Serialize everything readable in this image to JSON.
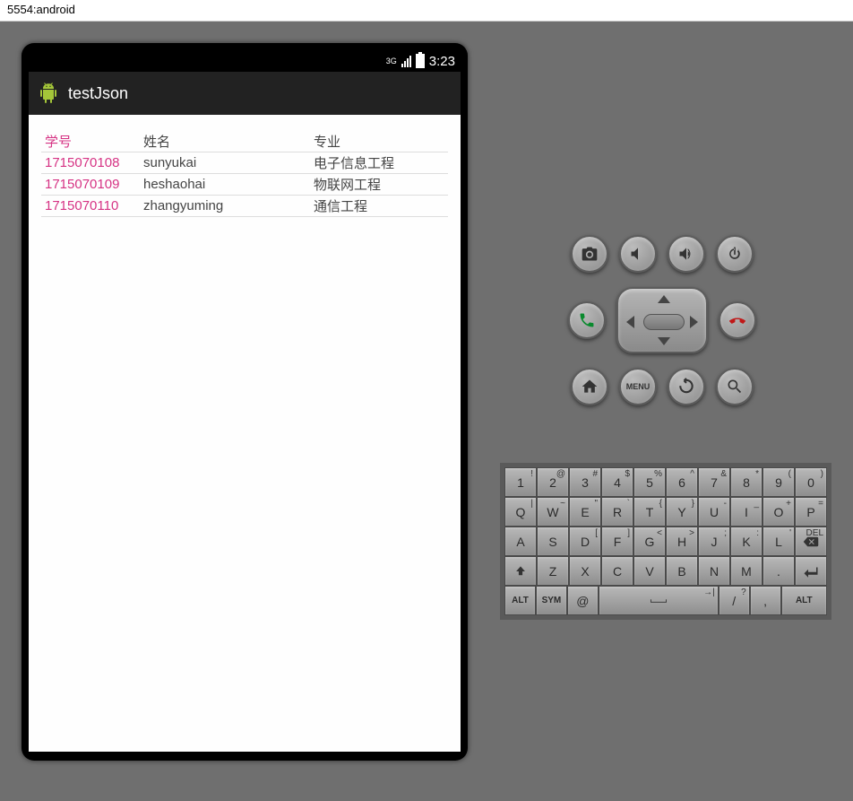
{
  "window": {
    "title": "5554:android"
  },
  "status": {
    "network": "3G",
    "time": "3:23"
  },
  "app": {
    "title": "testJson"
  },
  "table": {
    "headers": {
      "id": "学号",
      "name": "姓名",
      "major": "专业"
    },
    "rows": [
      {
        "id": "1715070108",
        "name": "sunyukai",
        "major": "电子信息工程"
      },
      {
        "id": "1715070109",
        "name": "heshaohai",
        "major": "物联网工程"
      },
      {
        "id": "1715070110",
        "name": "zhangyuming",
        "major": "通信工程"
      }
    ]
  },
  "controls": {
    "camera": "camera",
    "vol_down": "volume-down",
    "vol_up": "volume-up",
    "power": "power",
    "call": "call",
    "hangup": "hangup",
    "home": "home",
    "menu": "MENU",
    "back": "back",
    "search": "search"
  },
  "keyboard": {
    "row1": [
      {
        "m": "1",
        "s": "!"
      },
      {
        "m": "2",
        "s": "@"
      },
      {
        "m": "3",
        "s": "#"
      },
      {
        "m": "4",
        "s": "$"
      },
      {
        "m": "5",
        "s": "%"
      },
      {
        "m": "6",
        "s": "^"
      },
      {
        "m": "7",
        "s": "&"
      },
      {
        "m": "8",
        "s": "*"
      },
      {
        "m": "9",
        "s": "("
      },
      {
        "m": "0",
        "s": ")"
      }
    ],
    "row2": [
      {
        "m": "Q",
        "s": "|"
      },
      {
        "m": "W",
        "s": "~"
      },
      {
        "m": "E",
        "s": "\""
      },
      {
        "m": "R",
        "s": "`"
      },
      {
        "m": "T",
        "s": "{"
      },
      {
        "m": "Y",
        "s": "}"
      },
      {
        "m": "U",
        "s": "-"
      },
      {
        "m": "I",
        "s": "_"
      },
      {
        "m": "O",
        "s": "+"
      },
      {
        "m": "P",
        "s": "="
      }
    ],
    "row3": [
      {
        "m": "A",
        "s": ""
      },
      {
        "m": "S",
        "s": ""
      },
      {
        "m": "D",
        "s": "["
      },
      {
        "m": "F",
        "s": "]"
      },
      {
        "m": "G",
        "s": "<"
      },
      {
        "m": "H",
        "s": ">"
      },
      {
        "m": "J",
        "s": ";"
      },
      {
        "m": "K",
        "s": ":"
      },
      {
        "m": "L",
        "s": "'"
      }
    ],
    "row3_del": "DEL",
    "row4": [
      {
        "m": "Z",
        "s": ""
      },
      {
        "m": "X",
        "s": ""
      },
      {
        "m": "C",
        "s": ""
      },
      {
        "m": "V",
        "s": ""
      },
      {
        "m": "B",
        "s": ""
      },
      {
        "m": "N",
        "s": ""
      },
      {
        "m": "M",
        "s": ""
      },
      {
        "m": ".",
        "s": ""
      }
    ],
    "row5": {
      "alt": "ALT",
      "sym": "SYM",
      "at": "@",
      "comma": ",",
      "slash": "/",
      "slash_sup": "?",
      "alt2": "ALT"
    }
  }
}
